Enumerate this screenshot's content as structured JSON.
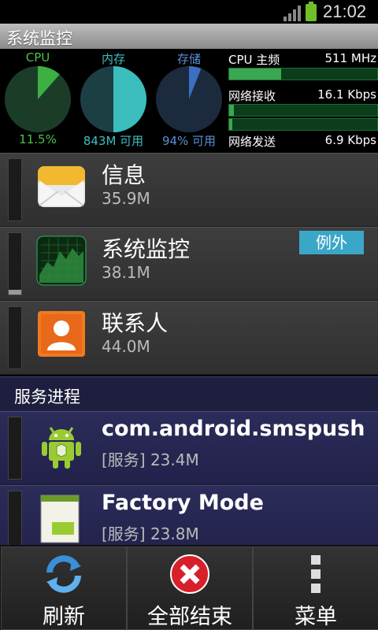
{
  "status_bar": {
    "time": "21:02"
  },
  "title_bar": {
    "title": "系统监控"
  },
  "dashboard": {
    "gauges": [
      {
        "label": "CPU",
        "value_text": "11.5%",
        "fraction": 0.115,
        "label_color": "#4dc246",
        "fill_color": "#3cb043",
        "base_color": "#1b3d28"
      },
      {
        "label": "内存",
        "value_text": "843M 可用",
        "fraction": 0.5,
        "label_color": "#3dc0c4",
        "fill_color": "#3bbdbd",
        "base_color": "#1c3f44"
      },
      {
        "label": "存储",
        "value_text": "94% 可用",
        "fraction": 0.06,
        "label_color": "#5b8fd6",
        "fill_color": "#3b6fbf",
        "base_color": "#1c2a3e"
      }
    ],
    "cpu_freq": {
      "label": "CPU 主频",
      "value": "511 MHz",
      "fraction": 0.35
    },
    "net_rx": {
      "label": "网络接收",
      "value": "16.1 Kbps",
      "fraction": 0.03
    },
    "net_tx": {
      "label": "网络发送",
      "value": "6.9 Kbps",
      "fraction": 0.02
    }
  },
  "processes": [
    {
      "name": "信息",
      "memory": "35.9M",
      "icon": "message-icon",
      "usage": 0
    },
    {
      "name": "系统监控",
      "memory": "38.1M",
      "icon": "system-monitor-icon",
      "badge": "例外",
      "usage": 0.08
    },
    {
      "name": "联系人",
      "memory": "44.0M",
      "icon": "contacts-icon",
      "usage": 0
    }
  ],
  "services_section": {
    "title": "服务进程"
  },
  "services": [
    {
      "name": "com.android.smspush",
      "memory": "[服务] 23.4M",
      "icon": "android-icon"
    },
    {
      "name": "Factory Mode",
      "memory": "[服务] 23.8M",
      "icon": "factory-mode-icon"
    }
  ],
  "bottom_bar": {
    "refresh_label": "刷新",
    "kill_all_label": "全部结束",
    "menu_label": "菜单"
  }
}
